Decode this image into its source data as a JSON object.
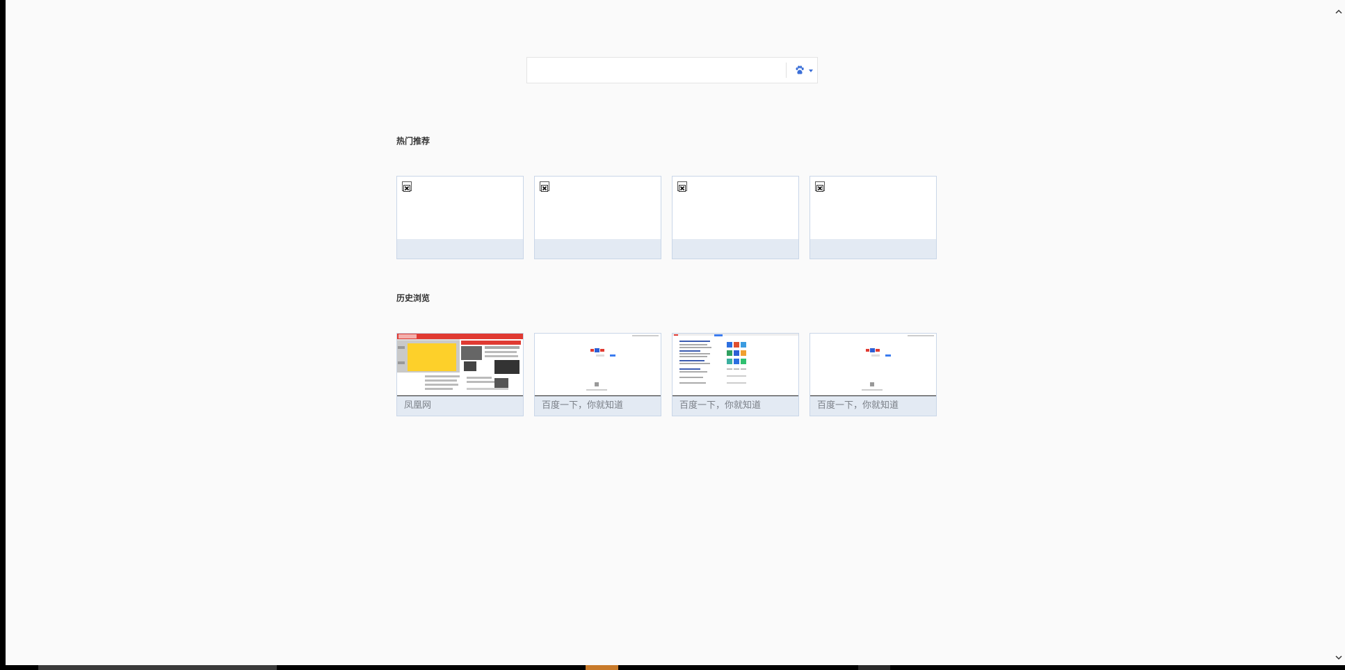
{
  "search": {
    "placeholder": "",
    "engine_icon": "baidu-paw-icon"
  },
  "sections": {
    "hot": {
      "title": "热门推荐"
    },
    "history": {
      "title": "历史浏览"
    }
  },
  "hot_tiles": [
    {
      "label": "",
      "icon": "broken-image-icon"
    },
    {
      "label": "",
      "icon": "broken-image-icon"
    },
    {
      "label": "",
      "icon": "broken-image-icon"
    },
    {
      "label": "",
      "icon": "broken-image-icon"
    }
  ],
  "history_tiles": [
    {
      "label": "凤凰网"
    },
    {
      "label": "百度一下，你就知道"
    },
    {
      "label": "百度一下，你就知道"
    },
    {
      "label": "百度一下，你就知道"
    }
  ],
  "colors": {
    "accent": "#3b6fd8",
    "tile_border": "#c9d6e8",
    "tile_label_bg": "#e3eaf3",
    "page_bg": "#fafafa"
  }
}
